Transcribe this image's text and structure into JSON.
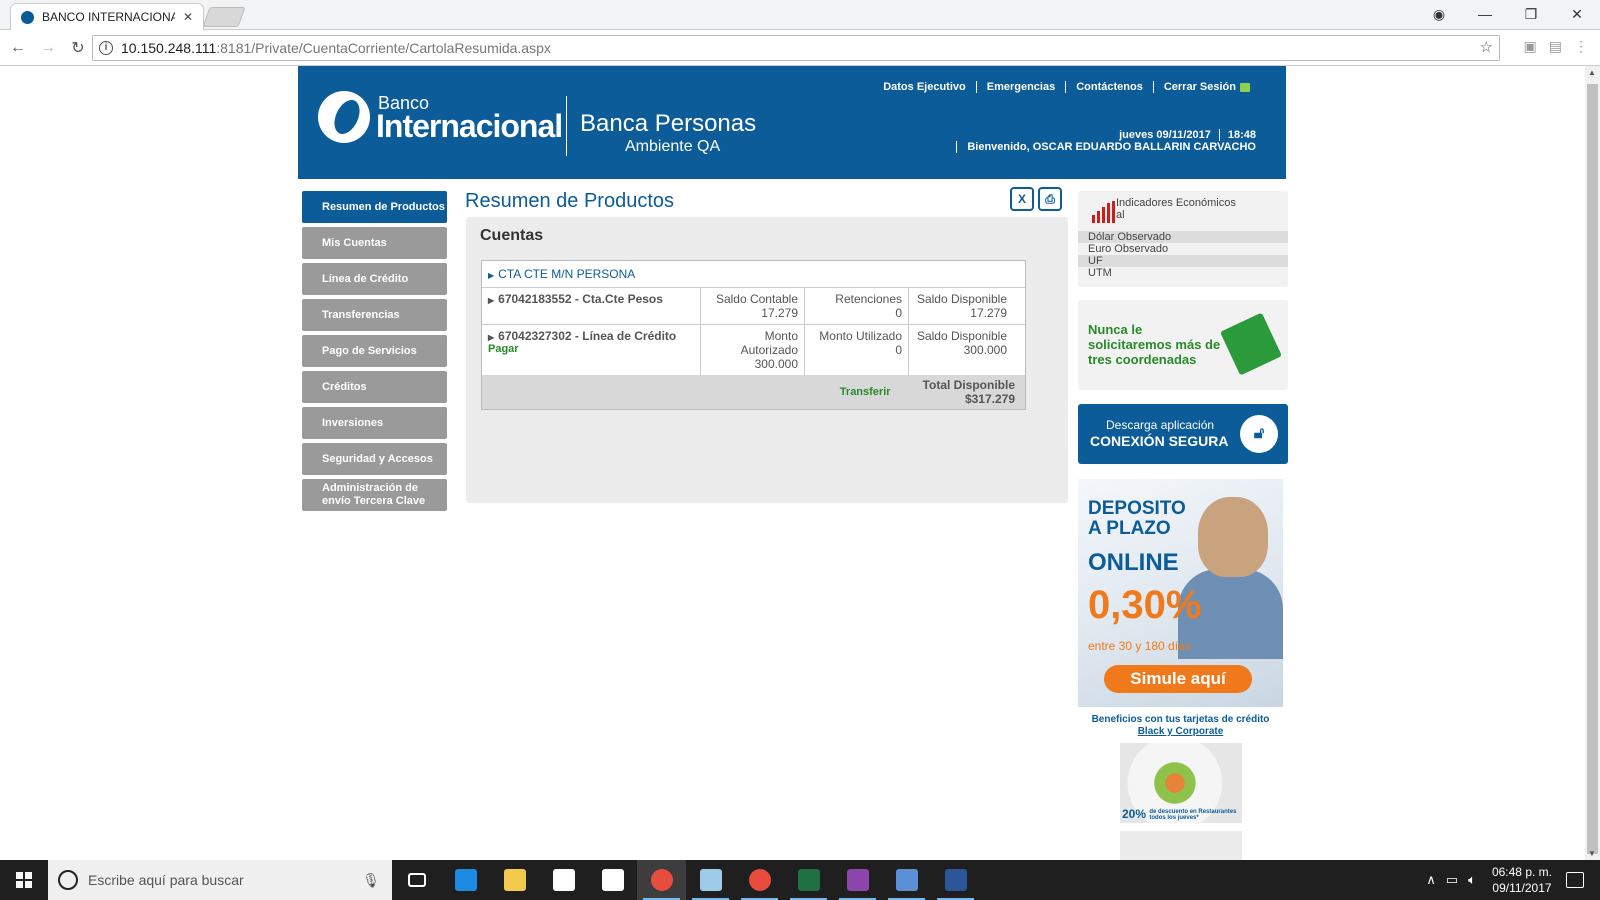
{
  "browser": {
    "tab_title": "BANCO INTERNACIONAL",
    "tab_close": "✕",
    "url_host": "10.150.248.111",
    "url_rest": ":8181/Private/CuentaCorriente/CartolaResumida.aspx",
    "win_buttons": [
      "◉",
      "—",
      "❐",
      "✕"
    ]
  },
  "header": {
    "logo_top": "Banco",
    "logo_main": "Internacional",
    "product": "Banca Personas",
    "environment": "Ambiente QA",
    "links": [
      "Datos Ejecutivo",
      "Emergencias",
      "Contáctenos",
      "Cerrar Sesión"
    ],
    "date": "jueves 09/11/2017",
    "time": "18:48",
    "welcome": "Bienvenido, OSCAR EDUARDO BALLARIN CARVACHO"
  },
  "sidebar": {
    "items": [
      {
        "label": "Resumen de Productos",
        "active": true
      },
      {
        "label": "Mis Cuentas"
      },
      {
        "label": "Línea de Crédito"
      },
      {
        "label": "Transferencias"
      },
      {
        "label": "Pago de Servicios"
      },
      {
        "label": "Créditos"
      },
      {
        "label": "Inversiones"
      },
      {
        "label": "Seguridad y Accesos"
      },
      {
        "label": "Administración de envío Tercera Clave"
      }
    ]
  },
  "main": {
    "title": "Resumen de Productos",
    "excel_icon": "X",
    "print_icon": "⎙",
    "section": "Cuentas",
    "group": "CTA CTE M/N PERSONA",
    "accounts": [
      {
        "name": "67042183552 - Cta.Cte Pesos",
        "cols": [
          {
            "label": "Saldo Contable",
            "value": "17.279"
          },
          {
            "label": "Retenciones",
            "value": "0"
          },
          {
            "label": "Saldo Disponible",
            "value": "17.279"
          }
        ]
      },
      {
        "name": "67042327302 - Línea de Crédito",
        "action": "Pagar",
        "cols": [
          {
            "label": "Monto Autorizado",
            "value": "300.000"
          },
          {
            "label": "Monto Utilizado",
            "value": "0"
          },
          {
            "label": "Saldo Disponible",
            "value": "300.000"
          }
        ]
      }
    ],
    "transfer": "Transferir",
    "total_label": "Total Disponible",
    "total_value": "$317.279"
  },
  "indicators": {
    "title": "Indicadores Económicos",
    "subtitle": "al",
    "rows": [
      "Dólar Observado",
      "Euro Observado",
      "UF",
      "UTM"
    ]
  },
  "coord_banner": {
    "text": "Nunca le solicitaremos más de tres coordenadas"
  },
  "app_banner": {
    "line1": "Descarga aplicación",
    "line2": "CONEXIÓN SEGURA"
  },
  "promo": {
    "l1": "DEPOSITO",
    "l2": "A PLAZO",
    "l3": "ONLINE",
    "rate": "0,30%",
    "days": "entre 30 y 180 días",
    "button": "Simule aquí",
    "benefits": "Beneficios con tus tarjetas de crédito",
    "benefits_link": "Black y Corporate",
    "discount": "20%",
    "discount_text": "de descuento en Restaurantes todos los jueves*"
  },
  "taskbar": {
    "search_placeholder": "Escribe aquí para buscar",
    "time": "06:48 p. m.",
    "date": "09/11/2017",
    "apps": [
      {
        "name": "task-view",
        "color": "#1f1f1f"
      },
      {
        "name": "edge",
        "color": "#1e88e5"
      },
      {
        "name": "file-explorer",
        "color": "#f2c94c"
      },
      {
        "name": "store",
        "color": "#ffffff"
      },
      {
        "name": "mail",
        "color": "#ffffff"
      },
      {
        "name": "chrome",
        "color": "#e74c3c"
      },
      {
        "name": "notepad",
        "color": "#9ecbe8"
      },
      {
        "name": "chrome-2",
        "color": "#e74c3c"
      },
      {
        "name": "excel",
        "color": "#1e7145"
      },
      {
        "name": "visual-studio",
        "color": "#8e44ad"
      },
      {
        "name": "remote-desktop",
        "color": "#5b8fd6"
      },
      {
        "name": "word",
        "color": "#2b579a"
      }
    ]
  }
}
